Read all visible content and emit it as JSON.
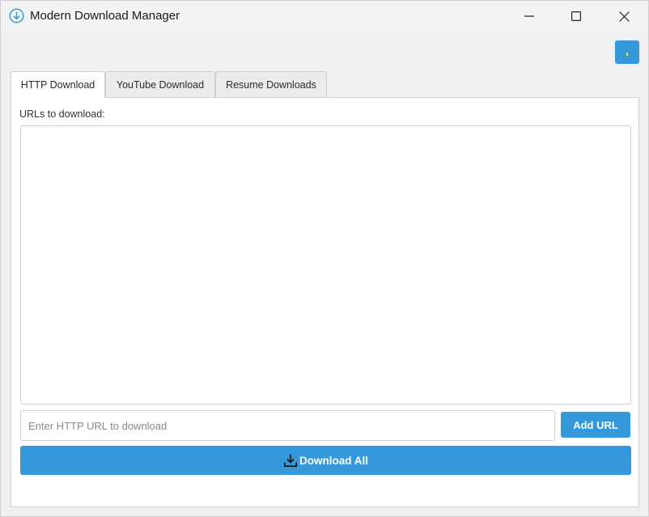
{
  "window": {
    "title": "Modern Download Manager",
    "app_icon": "download-circle-icon"
  },
  "colors": {
    "accent": "#3498db",
    "accent_dot": "#f1e33a",
    "background": "#f0f0f0",
    "panel": "#ffffff"
  },
  "titlebar_buttons": {
    "minimize_icon": "minimize-icon",
    "maximize_icon": "maximize-icon",
    "close_icon": "close-icon"
  },
  "tabs": [
    {
      "label": "HTTP Download",
      "active": true
    },
    {
      "label": "YouTube Download",
      "active": false
    },
    {
      "label": "Resume Downloads",
      "active": false
    }
  ],
  "http_tab": {
    "urls_label": "URLs to download:",
    "url_list_items": [],
    "url_input": {
      "value": "",
      "placeholder": "Enter HTTP URL to download"
    },
    "add_url_label": "Add URL",
    "download_all_label": "Download All",
    "download_all_icon": "download-tray-icon"
  }
}
